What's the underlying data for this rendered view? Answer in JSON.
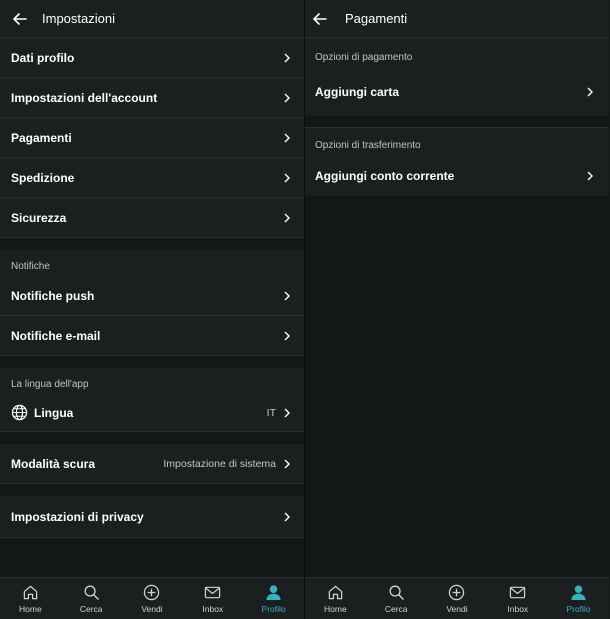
{
  "left": {
    "header": {
      "title": "Impostazioni"
    },
    "group1": [
      {
        "label": "Dati profilo"
      },
      {
        "label": "Impostazioni dell'account"
      },
      {
        "label": "Pagamenti"
      },
      {
        "label": "Spedizione"
      },
      {
        "label": "Sicurezza"
      }
    ],
    "notifications": {
      "heading": "Notifiche",
      "items": [
        {
          "label": "Notifiche push"
        },
        {
          "label": "Notifiche e-mail"
        }
      ]
    },
    "language": {
      "heading": "La lingua dell'app",
      "label": "Lingua",
      "value": "IT"
    },
    "dark_mode": {
      "label": "Modalità scura",
      "value": "Impostazione di sistema"
    },
    "privacy": {
      "label": "Impostazioni di privacy"
    }
  },
  "right": {
    "header": {
      "title": "Pagamenti"
    },
    "payment": {
      "heading": "Opzioni di pagamento",
      "item": "Aggiungi carta"
    },
    "transfer": {
      "heading": "Opzioni di trasferimento",
      "item": "Aggiungi conto corrente"
    }
  },
  "nav": {
    "items": [
      {
        "label": "Home",
        "icon": "home-icon"
      },
      {
        "label": "Cerca",
        "icon": "search-icon"
      },
      {
        "label": "Vendi",
        "icon": "plus-circle-icon"
      },
      {
        "label": "Inbox",
        "icon": "mail-icon"
      },
      {
        "label": "Profilo",
        "icon": "person-icon"
      }
    ],
    "active_color": "#39b0c0"
  }
}
